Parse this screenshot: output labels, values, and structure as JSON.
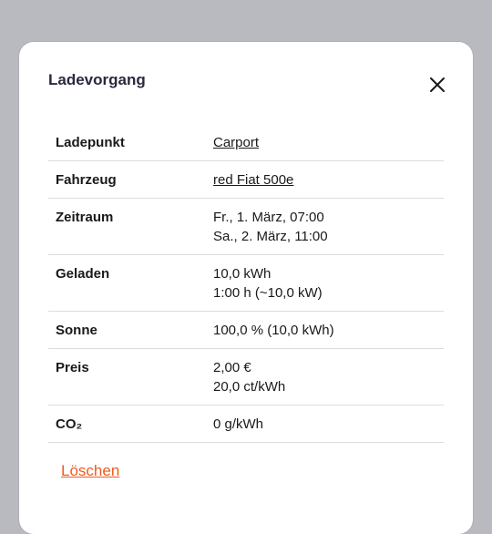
{
  "modal": {
    "title": "Ladevorgang",
    "close_label": "close"
  },
  "details": {
    "ladepunkt": {
      "label": "Ladepunkt",
      "value": "Carport"
    },
    "fahrzeug": {
      "label": "Fahrzeug",
      "value": "red Fiat 500e"
    },
    "zeitraum": {
      "label": "Zeitraum",
      "start": "Fr., 1. März, 07:00",
      "end": "Sa., 2. März, 11:00"
    },
    "geladen": {
      "label": "Geladen",
      "energy": "10,0 kWh",
      "duration": "1:00 h (~10,0 kW)"
    },
    "sonne": {
      "label": "Sonne",
      "value": "100,0 % (10,0 kWh)"
    },
    "preis": {
      "label": "Preis",
      "total": "2,00 €",
      "per_kwh": "20,0 ct/kWh"
    },
    "co2": {
      "label": "CO₂",
      "value": "0 g/kWh"
    }
  },
  "actions": {
    "delete_label": "Löschen"
  },
  "colors": {
    "backdrop": "#b9bac0",
    "accent_danger": "#f05a1e",
    "title": "#28293e"
  }
}
